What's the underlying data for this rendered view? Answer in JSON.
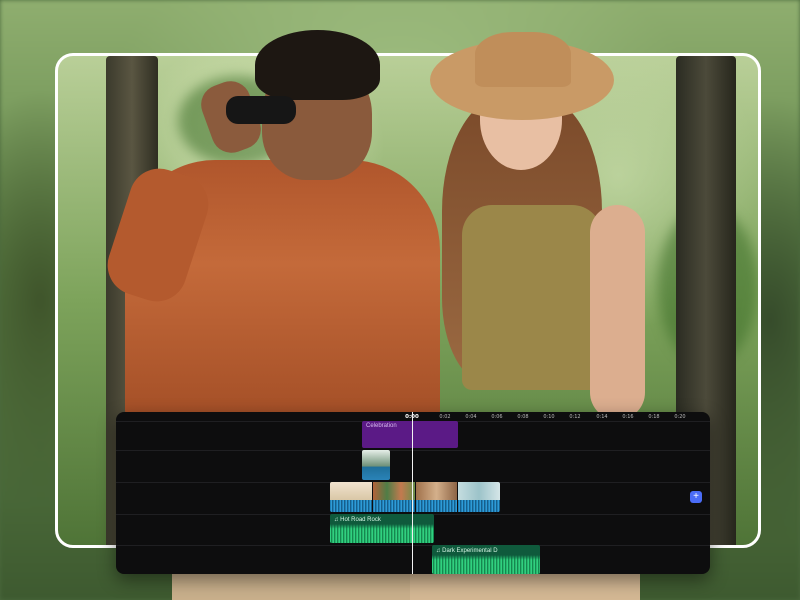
{
  "timeline": {
    "ruler": {
      "current": "0:00",
      "ticks": [
        "0:02",
        "0:04",
        "0:06",
        "0:08",
        "0:10",
        "0:12",
        "0:14",
        "0:16",
        "0:18",
        "0:20"
      ]
    },
    "text_clip": {
      "label": "Celebration"
    },
    "audio_clips": [
      {
        "label": "Hot Road Rock",
        "icon": "music-note-icon"
      },
      {
        "label": "Dark Experimental D",
        "icon": "music-note-icon"
      }
    ],
    "add_button": {
      "label": "+"
    }
  },
  "colors": {
    "timeline_bg": "#0d0d0e",
    "text_clip": "#5b1a86",
    "video_wave": "#2f9bd6",
    "audio_clip": "#0f5a3c",
    "audio_wave": "#2fd17f",
    "add_button": "#4a6cf7"
  }
}
